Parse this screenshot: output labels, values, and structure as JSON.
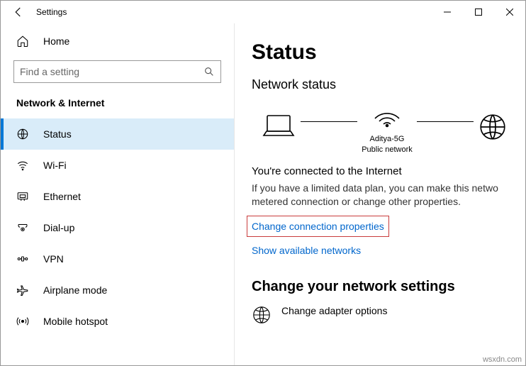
{
  "window": {
    "title": "Settings"
  },
  "sidebar": {
    "home_label": "Home",
    "search_placeholder": "Find a setting",
    "section_label": "Network & Internet",
    "items": [
      {
        "label": "Status"
      },
      {
        "label": "Wi-Fi"
      },
      {
        "label": "Ethernet"
      },
      {
        "label": "Dial-up"
      },
      {
        "label": "VPN"
      },
      {
        "label": "Airplane mode"
      },
      {
        "label": "Mobile hotspot"
      }
    ]
  },
  "main": {
    "heading": "Status",
    "network_status_label": "Network status",
    "network_name": "Aditya-5G",
    "network_type": "Public network",
    "connected_title": "You're connected to the Internet",
    "connected_desc": "If you have a limited data plan, you can make this netwo metered connection or change other properties.",
    "change_props_link": "Change connection properties",
    "show_networks_link": "Show available networks",
    "change_settings_heading": "Change your network settings",
    "adapter_options_label": "Change adapter options"
  },
  "watermark": "wsxdn.com"
}
